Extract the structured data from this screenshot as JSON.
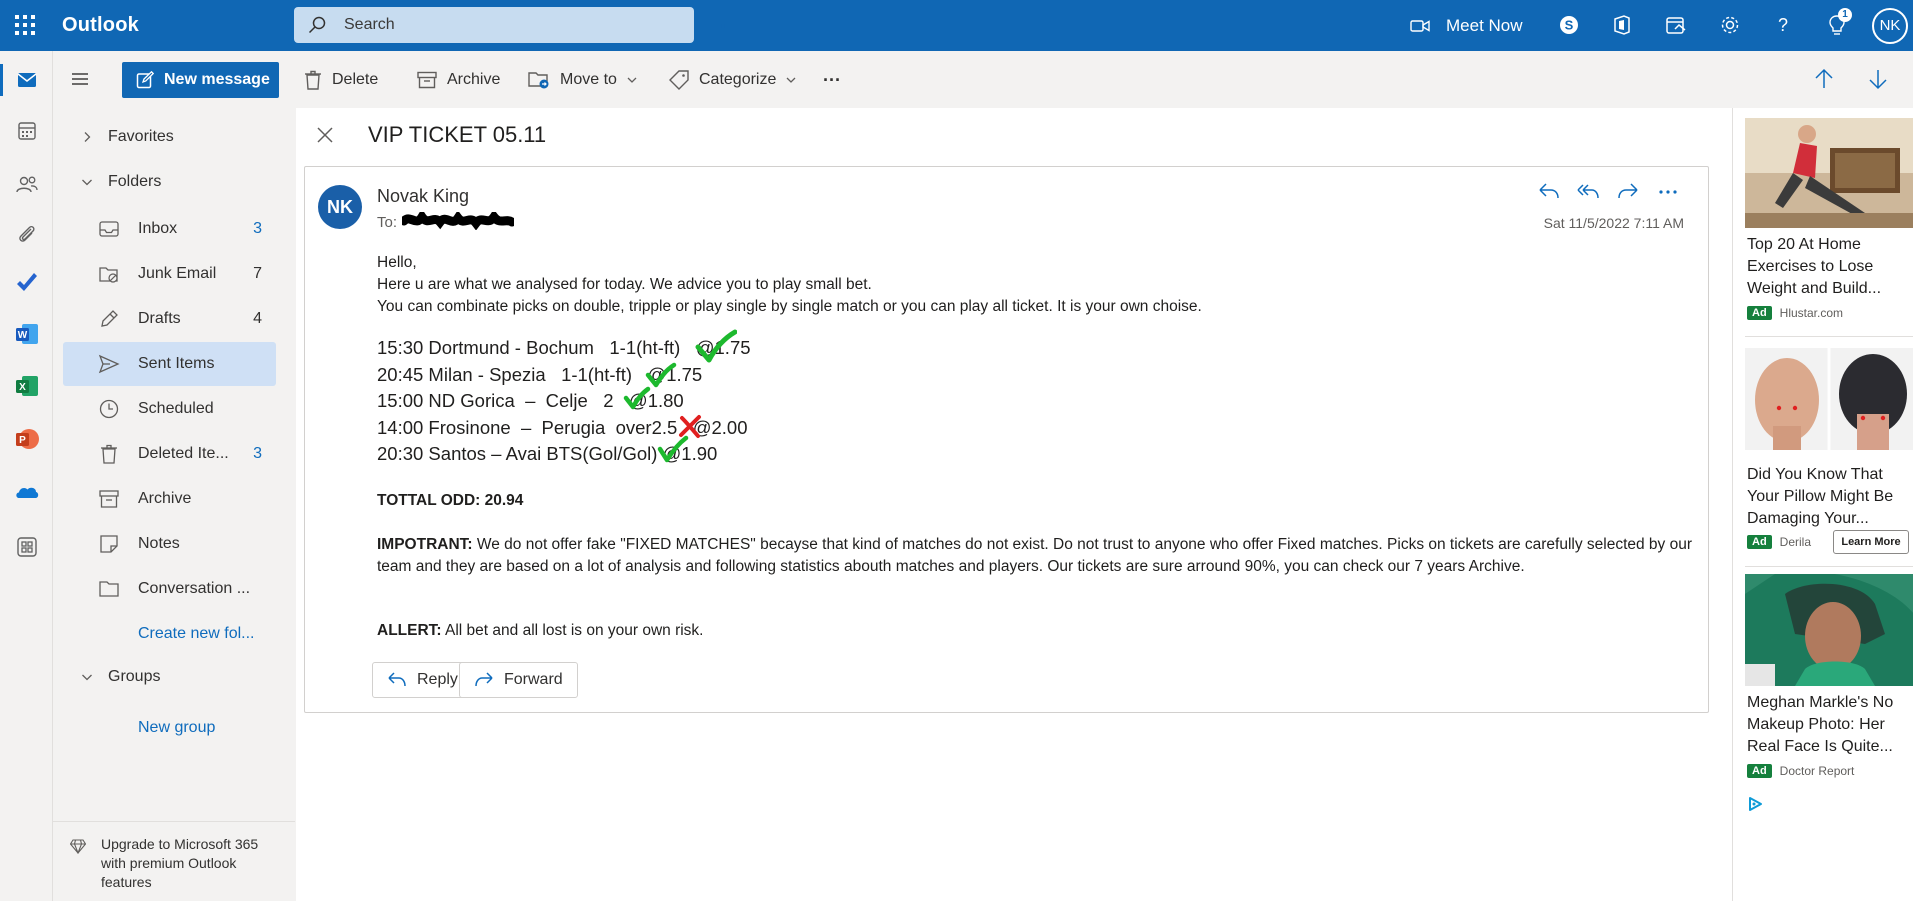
{
  "header": {
    "app_name": "Outlook",
    "search_placeholder": "Search",
    "meet_now": "Meet Now",
    "notification_count": "1",
    "user_initials": "NK"
  },
  "toolbar": {
    "new_message": "New message",
    "delete": "Delete",
    "archive": "Archive",
    "move_to": "Move to",
    "categorize": "Categorize",
    "more": "···"
  },
  "folders": {
    "favorites": "Favorites",
    "folders": "Folders",
    "items": [
      {
        "label": "Inbox",
        "count": "3"
      },
      {
        "label": "Junk Email",
        "count": "7"
      },
      {
        "label": "Drafts",
        "count": "4"
      },
      {
        "label": "Sent Items",
        "count": ""
      },
      {
        "label": "Scheduled",
        "count": ""
      },
      {
        "label": "Deleted Ite...",
        "count": "3"
      },
      {
        "label": "Archive",
        "count": ""
      },
      {
        "label": "Notes",
        "count": ""
      },
      {
        "label": "Conversation ...",
        "count": ""
      }
    ],
    "create_new_folder": "Create new fol...",
    "groups": "Groups",
    "new_group": "New group",
    "upgrade": "Upgrade to Microsoft 365 with premium Outlook features"
  },
  "message": {
    "subject": "VIP TICKET 05.11",
    "sender_initials": "NK",
    "sender": "Novak King",
    "to_label": "To:",
    "date": "Sat 11/5/2022 7:11 AM",
    "greeting": "Hello,",
    "line1": "Here u are what we analysed for today. We advice you to play small bet.",
    "line2": "You can combinate picks on double, tripple or play single by single match or you can play all ticket. It is your own choise.",
    "picks": [
      {
        "text": "15:30 Dortmund - Bochum   1-1(ht-ft)   @1.75",
        "result": "win"
      },
      {
        "text": "20:45 Milan - Spezia   1-1(ht-ft)   @1.75",
        "result": "win"
      },
      {
        "text": "15:00 ND Gorica  –  Celje   2   @1.80",
        "result": "win"
      },
      {
        "text": "14:00 Frosinone  –  Perugia  over2.5   @2.00",
        "result": "loss"
      },
      {
        "text": "20:30 Santos – Avai BTS(Gol/Gol) @1.90",
        "result": "win"
      }
    ],
    "total": "TOTTAL ODD: 20.94",
    "important_label": "IMPOTRANT:",
    "important_text": " We do not offer fake \"FIXED MATCHES\" becayse that kind of matches do not exist. Do not trust to anyone who offer Fixed matches. Picks on tickets are carefully selected by our team and they are based on a lot of analysis and following statistics abouth matches and players. Our tickets are sure arround 90%, you can check our 7 years Archive.",
    "allert_label": "ALLERT:",
    "allert_text": " All bet and all lost is on your own risk.",
    "reply": "Reply",
    "forward": "Forward"
  },
  "ads": [
    {
      "title": "Top 20 At Home Exercises to Lose Weight and Build...",
      "tag": "Ad",
      "source": "Hlustar.com"
    },
    {
      "title": "Did You Know That Your Pillow Might Be Damaging Your...",
      "tag": "Ad",
      "source": "Derila",
      "cta": "Learn More"
    },
    {
      "title": "Meghan Markle's No Makeup Photo: Her Real Face Is Quite...",
      "tag": "Ad",
      "source": "Doctor Report"
    }
  ],
  "colors": {
    "brand_blue": "#1067b4",
    "selected_folder": "#cfe0f5",
    "check_green": "#1db92e",
    "cross_red": "#e02020"
  }
}
